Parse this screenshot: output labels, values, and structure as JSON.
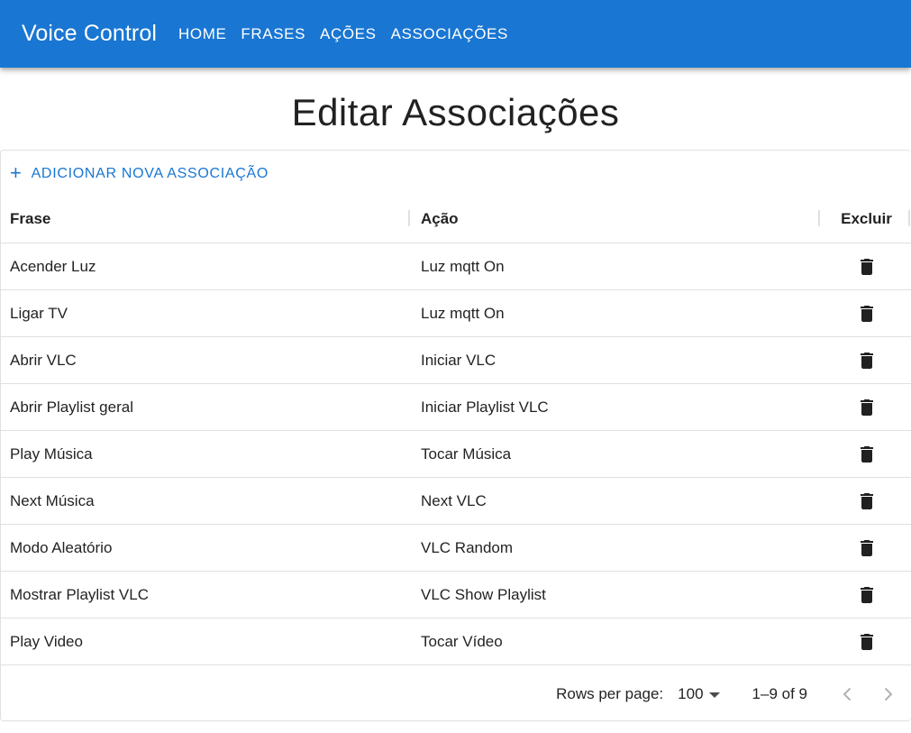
{
  "app": {
    "title": "Voice Control",
    "nav": [
      "HOME",
      "FRASES",
      "AÇÕES",
      "ASSOCIAÇÕES"
    ],
    "accent_color": "#1976d2"
  },
  "page": {
    "title": "Editar Associações"
  },
  "toolbar": {
    "add_icon": "plus-icon",
    "add_label": "ADICIONAR NOVA ASSOCIAÇÃO"
  },
  "table": {
    "columns": [
      "Frase",
      "Ação",
      "Excluir"
    ],
    "delete_icon": "trash-icon",
    "rows": [
      {
        "frase": "Acender Luz",
        "acao": "Luz mqtt On"
      },
      {
        "frase": "Ligar TV",
        "acao": "Luz mqtt On"
      },
      {
        "frase": "Abrir VLC",
        "acao": "Iniciar VLC"
      },
      {
        "frase": "Abrir Playlist geral",
        "acao": "Iniciar Playlist VLC"
      },
      {
        "frase": "Play Música",
        "acao": "Tocar Música"
      },
      {
        "frase": "Next Música",
        "acao": "Next VLC"
      },
      {
        "frase": "Modo Aleatório",
        "acao": "VLC Random"
      },
      {
        "frase": "Mostrar Playlist VLC",
        "acao": "VLC Show Playlist"
      },
      {
        "frase": "Play Video",
        "acao": "Tocar Vídeo"
      }
    ]
  },
  "pagination": {
    "rows_per_page_label": "Rows per page:",
    "rows_per_page_value": "100",
    "range": "1–9 of 9",
    "prev_icon": "chevron-left-icon",
    "next_icon": "chevron-right-icon"
  }
}
